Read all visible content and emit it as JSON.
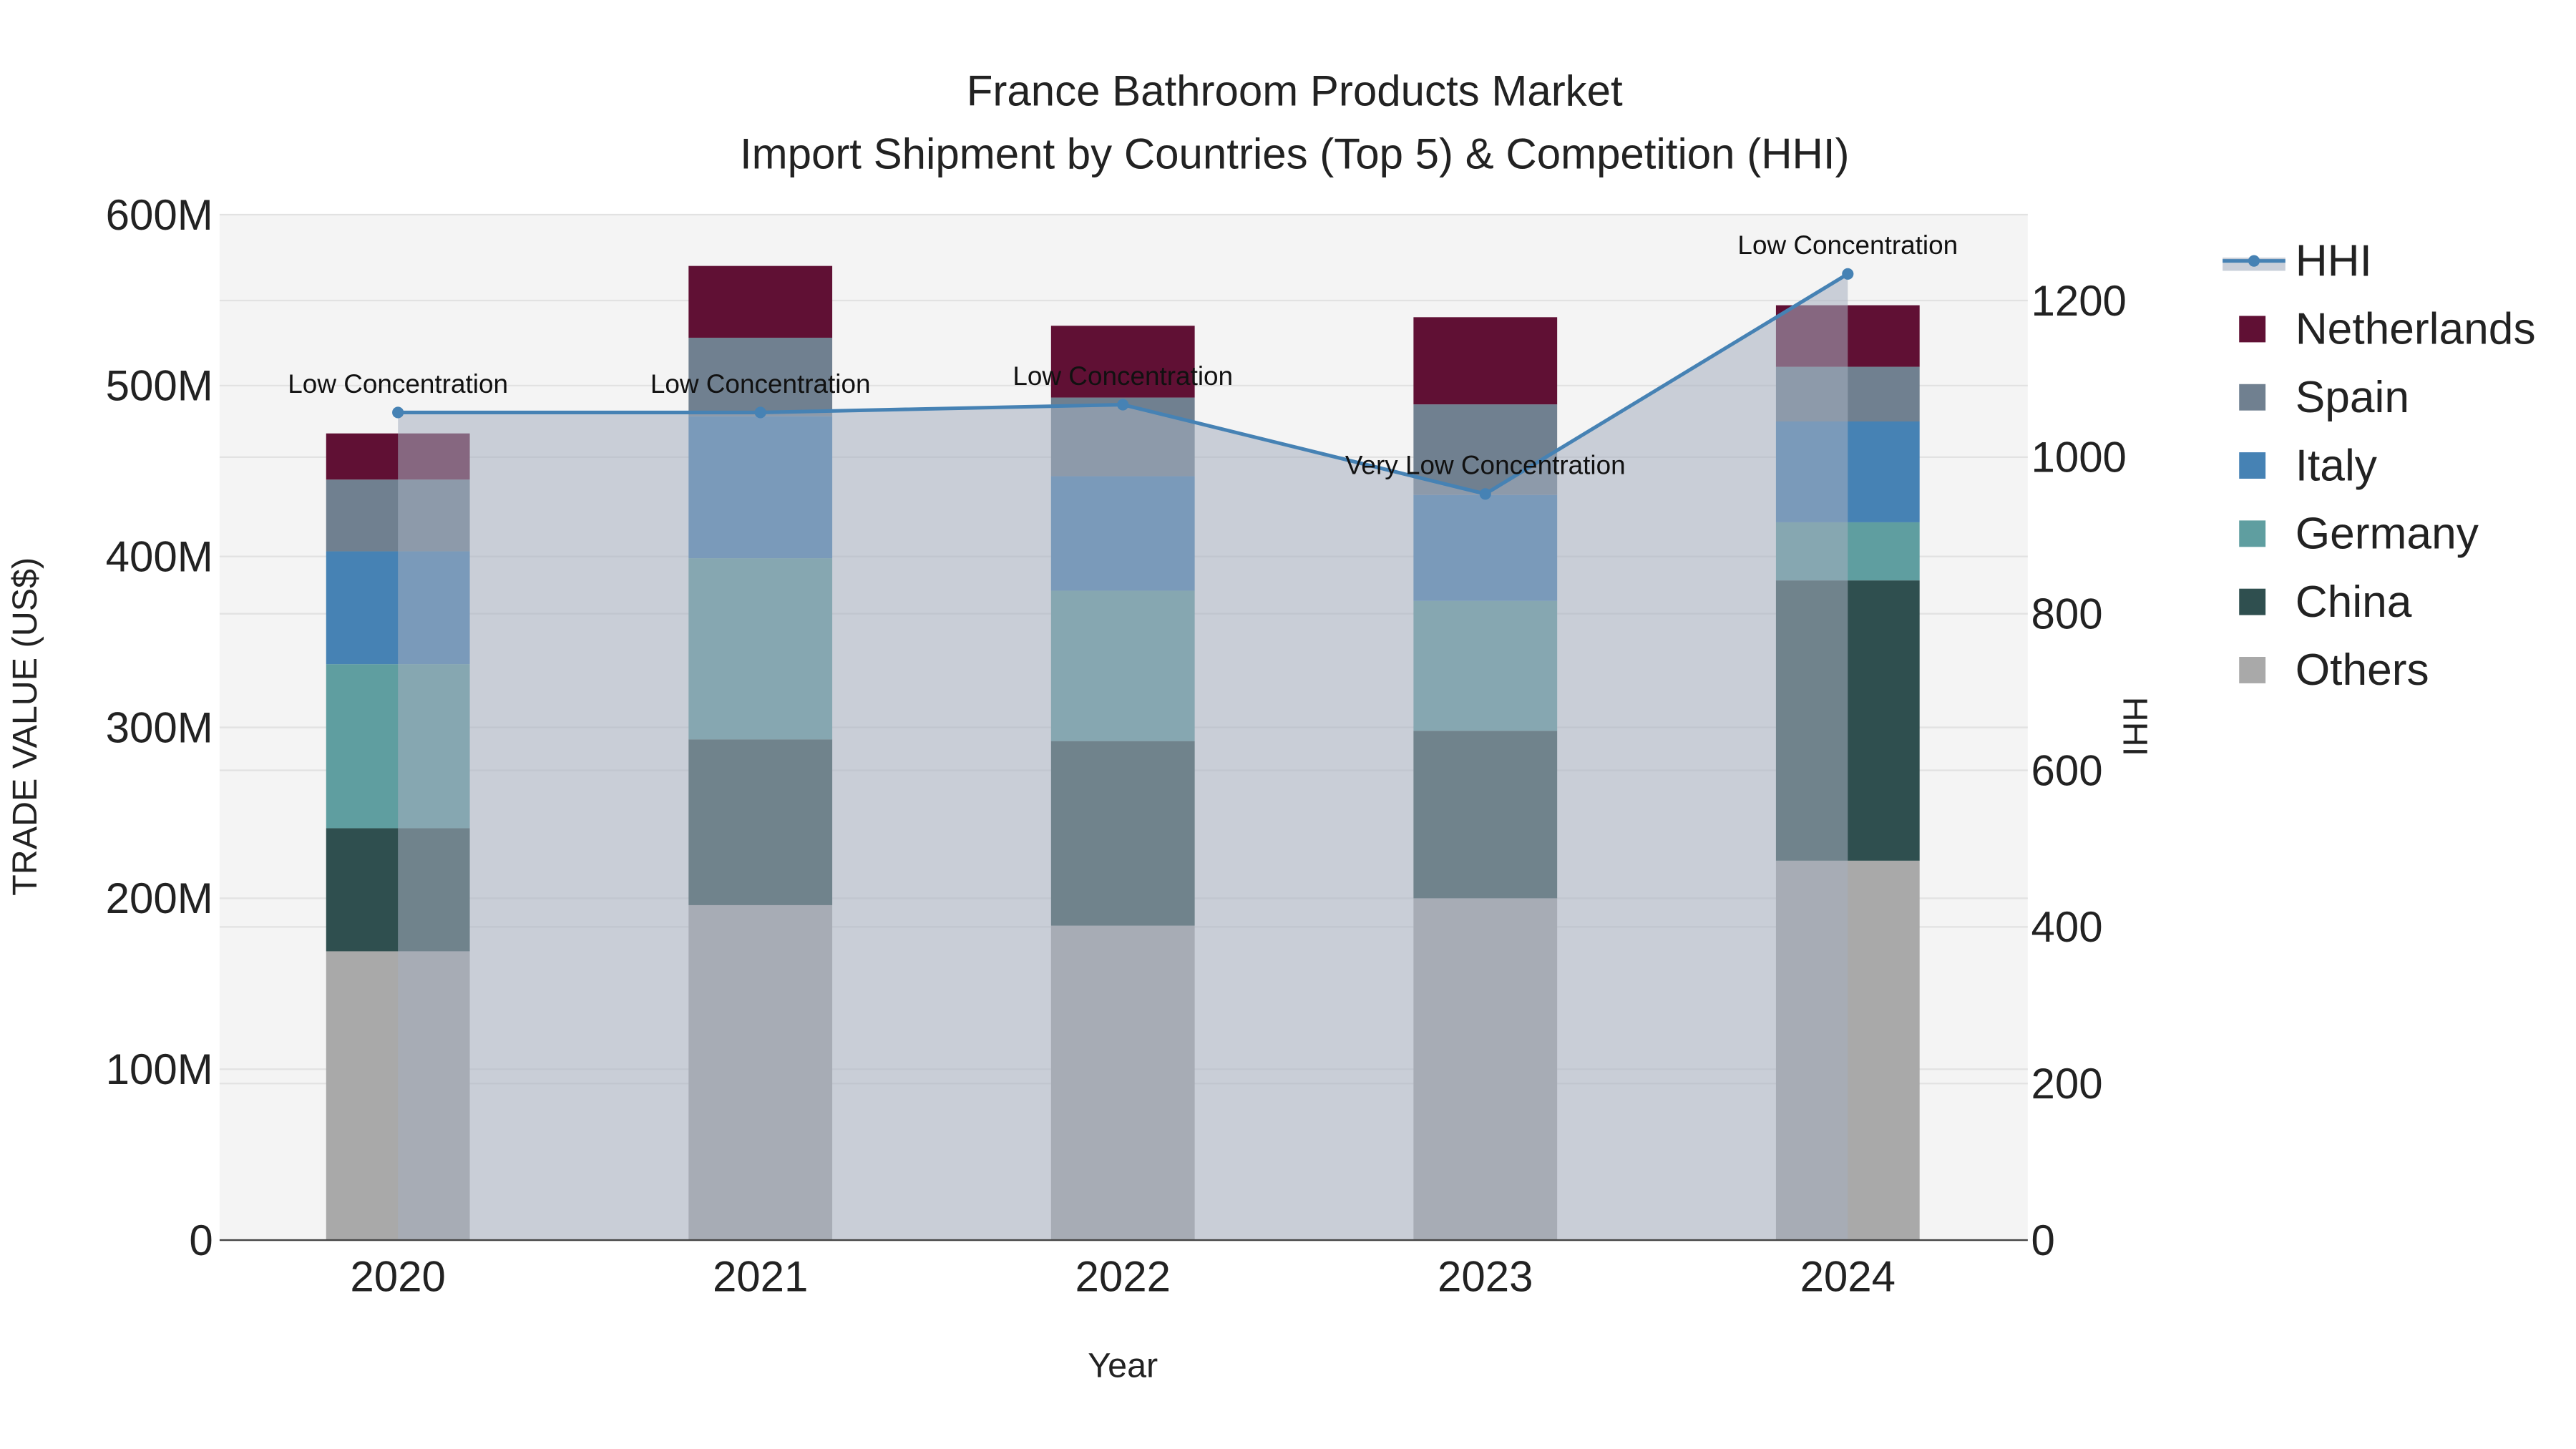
{
  "chart_data": {
    "type": "bar",
    "title_line1": "France Bathroom Products Market",
    "title_line2": "Import Shipment by Countries (Top 5) & Competition (HHI)",
    "xlabel": "Year",
    "ylabel": "TRADE VALUE (US$)",
    "y2label": "HHI",
    "categories": [
      "2020",
      "2021",
      "2022",
      "2023",
      "2024"
    ],
    "ylim": [
      0,
      600000000
    ],
    "yticks": [
      0,
      100000000,
      200000000,
      300000000,
      400000000,
      500000000,
      600000000
    ],
    "ytick_labels": [
      "0",
      "100M",
      "200M",
      "300M",
      "400M",
      "500M",
      "600M"
    ],
    "y2lim": [
      0,
      1310
    ],
    "y2ticks": [
      0,
      200,
      400,
      600,
      800,
      1000,
      1200
    ],
    "y2tick_labels": [
      "0",
      "200",
      "400",
      "600",
      "800",
      "1000",
      "1200"
    ],
    "series": [
      {
        "name": "Others",
        "color": "#a9a9a9",
        "values": [
          169000000,
          196000000,
          184000000,
          200000000,
          222000000
        ]
      },
      {
        "name": "China",
        "color": "#2f4f4f",
        "values": [
          72000000,
          97000000,
          108000000,
          98000000,
          164000000
        ]
      },
      {
        "name": "Germany",
        "color": "#5f9ea0",
        "values": [
          96000000,
          106000000,
          88000000,
          76000000,
          34000000
        ]
      },
      {
        "name": "Italy",
        "color": "#4682b4",
        "values": [
          66000000,
          83000000,
          67000000,
          62000000,
          59000000
        ]
      },
      {
        "name": "Spain",
        "color": "#708090",
        "values": [
          42000000,
          46000000,
          46000000,
          53000000,
          32000000
        ]
      },
      {
        "name": "Netherlands",
        "color": "#601034",
        "values": [
          27000000,
          42000000,
          42000000,
          51000000,
          36000000
        ]
      }
    ],
    "hhi": {
      "name": "HHI",
      "color": "#4682b4",
      "values": [
        1057,
        1057,
        1067,
        953,
        1234
      ],
      "annotations": [
        "Low Concentration",
        "Low Concentration",
        "Low Concentration",
        "Very Low Concentration",
        "Low Concentration"
      ]
    },
    "legend_order": [
      "HHI",
      "Netherlands",
      "Spain",
      "Italy",
      "Germany",
      "China",
      "Others"
    ],
    "legend_placement": "right",
    "grid": true
  }
}
